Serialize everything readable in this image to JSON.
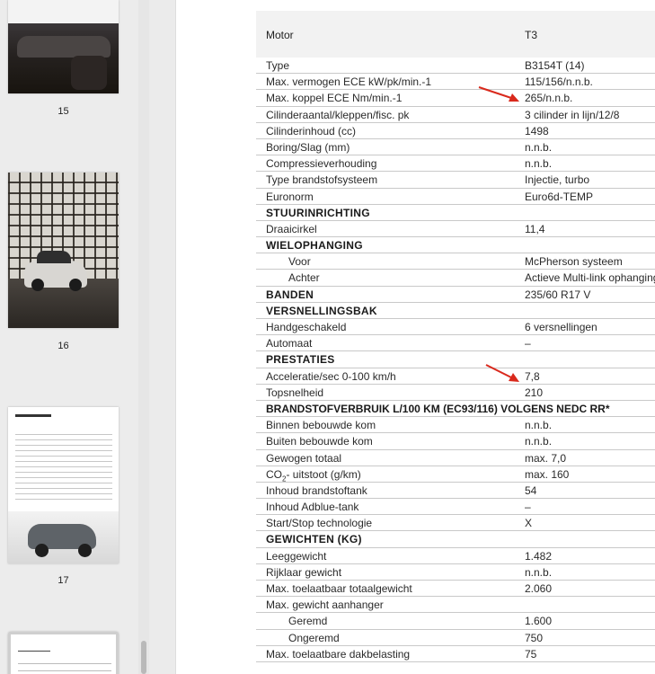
{
  "thumbnails": [
    {
      "page": "15"
    },
    {
      "page": "16"
    },
    {
      "page": "17"
    }
  ],
  "spec_table": {
    "header": {
      "label": "Motor",
      "value": "T3"
    },
    "rows": [
      {
        "label": "Type",
        "value": "B3154T (14)",
        "kind": "row"
      },
      {
        "label": "Max. vermogen ECE kW/pk/min.-1",
        "value": "115/156/n.n.b.",
        "kind": "row"
      },
      {
        "label": "Max. koppel ECE Nm/min.-1",
        "value": "265/n.n.b.",
        "kind": "row"
      },
      {
        "label": "Cilinderaantal/kleppen/fisc. pk",
        "value": "3 cilinder in lijn/12/8",
        "kind": "row"
      },
      {
        "label": "Cilinderinhoud (cc)",
        "value": "1498",
        "kind": "row"
      },
      {
        "label": "Boring/Slag (mm)",
        "value": "n.n.b.",
        "kind": "row"
      },
      {
        "label": "Compressieverhouding",
        "value": "n.n.b.",
        "kind": "row"
      },
      {
        "label": "Type brandstofsysteem",
        "value": "Injectie, turbo",
        "kind": "row"
      },
      {
        "label": "Euronorm",
        "value": "Euro6d-TEMP",
        "kind": "row"
      },
      {
        "label": "STUURINRICHTING",
        "value": "",
        "kind": "section"
      },
      {
        "label": "Draaicirkel",
        "value": "11,4",
        "kind": "row"
      },
      {
        "label": "WIELOPHANGING",
        "value": "",
        "kind": "section"
      },
      {
        "label": "Voor",
        "value": "McPherson systeem",
        "kind": "indent"
      },
      {
        "label": "Achter",
        "value": "Actieve Multi-link ophanging",
        "kind": "indent"
      },
      {
        "label": "BANDEN",
        "value": "235/60 R17 V",
        "kind": "section"
      },
      {
        "label": "VERSNELLINGSBAK",
        "value": "",
        "kind": "section"
      },
      {
        "label": "Handgeschakeld",
        "value": "6 versnellingen",
        "kind": "row"
      },
      {
        "label": "Automaat",
        "value": "–",
        "kind": "row"
      },
      {
        "label": "PRESTATIES",
        "value": "",
        "kind": "section"
      },
      {
        "label": "Acceleratie/sec 0-100 km/h",
        "value": "7,8",
        "kind": "row"
      },
      {
        "label": "Topsnelheid",
        "value": "210",
        "kind": "row"
      },
      {
        "label": "BRANDSTOFVERBRUIK L/100 KM (EC93/116) VOLGENS NEDC RR*",
        "value": "",
        "kind": "section"
      },
      {
        "label": "Binnen bebouwde kom",
        "value": "n.n.b.",
        "kind": "row"
      },
      {
        "label": "Buiten bebouwde kom",
        "value": "n.n.b.",
        "kind": "row"
      },
      {
        "label": "Gewogen totaal",
        "value": "max. 7,0",
        "kind": "row"
      },
      {
        "label": "CO2- uitstoot (g/km)",
        "value": "max. 160",
        "kind": "co2"
      },
      {
        "label": "Inhoud brandstoftank",
        "value": "54",
        "kind": "row"
      },
      {
        "label": "Inhoud Adblue-tank",
        "value": "–",
        "kind": "row"
      },
      {
        "label": "Start/Stop technologie",
        "value": "X",
        "kind": "row"
      },
      {
        "label": "GEWICHTEN (KG)",
        "value": "",
        "kind": "section"
      },
      {
        "label": "Leeggewicht",
        "value": "1.482",
        "kind": "row"
      },
      {
        "label": "Rijklaar gewicht",
        "value": "n.n.b.",
        "kind": "row"
      },
      {
        "label": "Max. toelaatbaar totaalgewicht",
        "value": "2.060",
        "kind": "row"
      },
      {
        "label": "Max. gewicht aanhanger",
        "value": "",
        "kind": "row"
      },
      {
        "label": "Geremd",
        "value": "1.600",
        "kind": "indent"
      },
      {
        "label": "Ongeremd",
        "value": "750",
        "kind": "indent"
      },
      {
        "label": "Max. toelaatbare dakbelasting",
        "value": "75",
        "kind": "row"
      }
    ]
  },
  "annotations": {
    "arrow_color": "#d9291c"
  }
}
